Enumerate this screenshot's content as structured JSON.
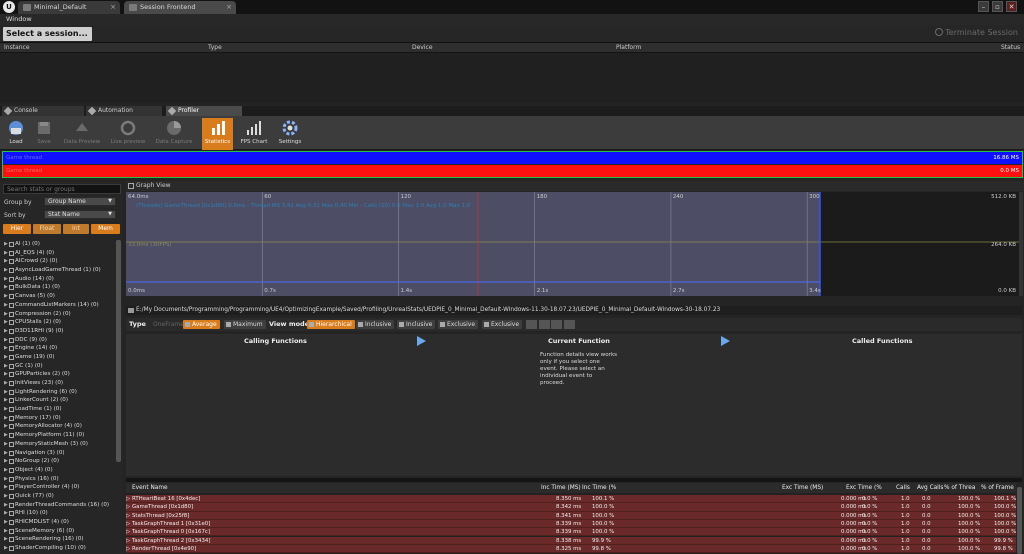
{
  "titlebar": {
    "tabs": [
      {
        "label": "Minimal_Default"
      },
      {
        "label": "Session Frontend"
      }
    ],
    "controls": {
      "minimize": "–",
      "maximize": "▫",
      "close": "✕"
    }
  },
  "menu": {
    "window": "Window"
  },
  "session": {
    "select_label": "Select a session...",
    "terminate_label": "Terminate Session",
    "columns": [
      "Instance",
      "Type",
      "Device",
      "Platform",
      "Status"
    ]
  },
  "tool_tabs": [
    {
      "label": "Console",
      "icon": "wrench-icon"
    },
    {
      "label": "Automation",
      "icon": "wrench-icon"
    },
    {
      "label": "Profiler",
      "icon": "wrench-icon"
    }
  ],
  "toolbar": [
    {
      "label": "Load",
      "icon": "load-icon",
      "state": "normal"
    },
    {
      "label": "Save",
      "icon": "save-icon",
      "state": "disabled"
    },
    {
      "label": "Data Preview",
      "icon": "data-preview-icon",
      "state": "disabled"
    },
    {
      "label": "Live preview",
      "icon": "live-preview-icon",
      "state": "disabled"
    },
    {
      "label": "Data Capture",
      "icon": "data-capture-icon",
      "state": "disabled"
    },
    {
      "label": "Statistics",
      "icon": "statistics-icon",
      "state": "active"
    },
    {
      "label": "FPS Chart",
      "icon": "fps-chart-icon",
      "state": "normal"
    },
    {
      "label": "Settings",
      "icon": "gear-icon",
      "state": "normal"
    }
  ],
  "thread_bars": [
    {
      "name": "Game thread",
      "value": "16.86 MS",
      "color": "#1010ff"
    },
    {
      "name": "Game thread",
      "value": "0.0 MS",
      "color": "#ff1010"
    }
  ],
  "left_panel": {
    "search_placeholder": "Search stats or groups",
    "group_by_label": "Group by",
    "group_by_value": "Group Name",
    "sort_by_label": "Sort by",
    "sort_by_value": "Stat Name",
    "filters": [
      {
        "label": "Hier",
        "state": "on"
      },
      {
        "label": "Float",
        "state": "off"
      },
      {
        "label": "Int",
        "state": "off"
      },
      {
        "label": "Mem",
        "state": "on"
      }
    ],
    "groups": [
      "AI (1) (0)",
      "AI_EQS (4) (0)",
      "AICrowd (2) (0)",
      "AsyncLoadGameThread (1) (0)",
      "Audio (14) (0)",
      "BulkData (1) (0)",
      "Canvas (5) (0)",
      "CommandListMarkers (14) (0)",
      "Compression (2) (0)",
      "CPUStalls (2) (0)",
      "D3D11RHI (9) (0)",
      "DDC (9) (0)",
      "Engine (14) (0)",
      "Game (19) (0)",
      "GC (1) (0)",
      "GPUParticles (2) (0)",
      "InitViews (23) (0)",
      "LightRendering (6) (0)",
      "LinkerCount (2) (0)",
      "LoadTime (1) (0)",
      "Memory (17) (0)",
      "MemoryAllocator (4) (0)",
      "MemoryPlatform (11) (0)",
      "MemoryStaticMesh (3) (0)",
      "Navigation (3) (0)",
      "NoGroup (2) (0)",
      "Object (4) (0)",
      "Physics (16) (0)",
      "PlayerController (4) (0)",
      "Quick (77) (0)",
      "RenderThreadCommands (16) (0)",
      "RHI (10) (0)",
      "RHICMDLIST (4) (0)",
      "SceneMemory (6) (0)",
      "SceneRendering (16) (0)",
      "ShaderCompiling (10) (0)",
      "Shaders (9) (0)"
    ]
  },
  "graph": {
    "title": "Graph View",
    "top_left": "64.0ms",
    "mid_left": "33.0ms (30FPS)",
    "bottom_left": "0.0ms",
    "frame_ticks": [
      {
        "label": "60",
        "frac": 0.1963
      },
      {
        "label": "120",
        "frac": 0.3926
      },
      {
        "label": "180",
        "frac": 0.5889
      },
      {
        "label": "240",
        "frac": 0.7852
      },
      {
        "label": "300",
        "frac": 0.9815
      }
    ],
    "time_ticks": [
      {
        "label": "0.7s",
        "frac": 0.1963
      },
      {
        "label": "1.4s",
        "frac": 0.3926
      },
      {
        "label": "2.1s",
        "frac": 0.5889
      },
      {
        "label": "2.7s",
        "frac": 0.7852
      },
      {
        "label": "3.4s",
        "frac": 0.9815
      }
    ],
    "right_top": "512.0 KB",
    "right_mid": "264.0 KB",
    "right_bottom": "0.0 KB",
    "legend_text": "(Threads) GameThread [0x1d80] 0.0ms - Thread MS 3.41 Avg 0.31 Max 0.40 Min - Calls (10) 0.0 Max 1.0 Avg 1.0 Max 1.0"
  },
  "path": "E:/My Documents/Programming/Programming/UE4/OptimizingExample/Saved/Profiling/UnrealStats/UEDPIE_0_Minimal_Default-Windows-11.30-18.07.23/UEDPIE_0_Minimal_Default-Windows-30-18.07.23",
  "options": {
    "type_label": "Type",
    "type_items": [
      {
        "label": "OneFrame",
        "state": "dis"
      },
      {
        "label": "Average",
        "state": "on"
      },
      {
        "label": "Maximum",
        "state": "off"
      }
    ],
    "view_mode_label": "View mode",
    "view_items": [
      {
        "label": "Hierarchical",
        "state": "on"
      },
      {
        "label": "Inclusive",
        "state": "off"
      },
      {
        "label": "Inclusive",
        "state": "off"
      },
      {
        "label": "Exclusive",
        "state": "off"
      },
      {
        "label": "Exclusive",
        "state": "off"
      }
    ]
  },
  "function_panel": {
    "calling": "Calling Functions",
    "current": "Current Function",
    "called": "Called Functions",
    "message": "Function details view works only if you select one event. Please select an individual event to proceed."
  },
  "event_table": {
    "columns": [
      "Event Name",
      "Inc Time (MS)",
      "Inc Time (%",
      "Exc Time (MS)",
      "Exc Time (%",
      "Calls",
      "Avg Calls",
      "% of Threa",
      "% of Frame"
    ],
    "rows": [
      [
        "RTHeartBeat 16 [0x4dec]",
        "8.350 ms",
        "100.1 %",
        "0.000 ms",
        "0.0 %",
        "1.0",
        "0.0",
        "100.0 %",
        "100.1 %"
      ],
      [
        "GameThread [0x1d80]",
        "8.342 ms",
        "100.0 %",
        "0.000 ms",
        "0.0 %",
        "1.0",
        "0.0",
        "100.0 %",
        "100.0 %"
      ],
      [
        "StatsThread [0x25f8]",
        "8.341 ms",
        "100.0 %",
        "0.000 ms",
        "0.0 %",
        "1.0",
        "0.0",
        "100.0 %",
        "100.0 %"
      ],
      [
        "TaskGraphThread 1 [0x31e0]",
        "8.339 ms",
        "100.0 %",
        "0.000 ms",
        "0.0 %",
        "1.0",
        "0.0",
        "100.0 %",
        "100.0 %"
      ],
      [
        "TaskGraphThread 0 [0x167c]",
        "8.339 ms",
        "100.0 %",
        "0.000 ms",
        "0.0 %",
        "1.0",
        "0.0",
        "100.0 %",
        "100.0 %"
      ],
      [
        "TaskGraphThread 2 [0x3434]",
        "8.338 ms",
        "99.9 %",
        "0.000 ms",
        "0.0 %",
        "1.0",
        "0.0",
        "100.0 %",
        "99.9 %"
      ],
      [
        "RenderThread [0x4e90]",
        "8.325 ms",
        "99.8 %",
        "0.000 ms",
        "0.0 %",
        "1.0",
        "0.0",
        "100.0 %",
        "99.8 %"
      ]
    ]
  }
}
